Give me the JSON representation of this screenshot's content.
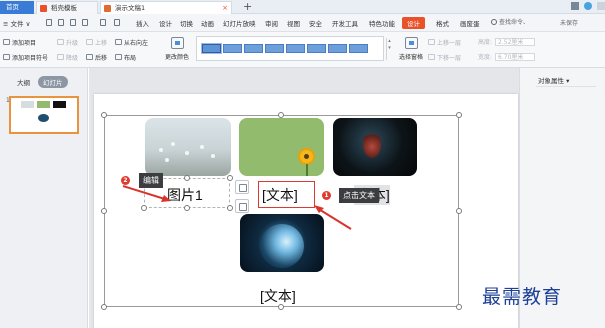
{
  "tabs": {
    "home": "首页",
    "template": "稻壳模板",
    "document": "演示文稿1",
    "close": "×",
    "add": "+"
  },
  "menu": {
    "file": "≡ 文件 ∨",
    "items": [
      "插入",
      "设计",
      "切换",
      "动画",
      "幻灯片放映",
      "审阅",
      "视图",
      "安全",
      "开发工具",
      "特色功能",
      "设计",
      "格式",
      "画废蛋"
    ],
    "active_index": 10,
    "search": "查找命令、",
    "save_status": "未保存"
  },
  "ribbon": {
    "add_item": "添加项目",
    "add_item_sign": "添加项目符号",
    "upgrade": "升级",
    "downgrade": "降级",
    "move_up": "上移",
    "move_down": "后移",
    "right_to_left": "从右向左",
    "layout": "布局",
    "change_color": "更改颜色",
    "select_pane": "选择窗格",
    "up_one": "上移一层",
    "down_one": "下移一层",
    "height_label": "高度:",
    "height_value": "2.52厘米",
    "width_label": "宽度:",
    "width_value": "6.70厘米",
    "gallery_scroll": "▴ ▾"
  },
  "left_panel": {
    "outline_tab": "大纲",
    "slides_tab": "幻灯片",
    "slide_number": "1"
  },
  "right_panel": {
    "title": "对象属性 ▾"
  },
  "slide": {
    "picture_caption": "图片1",
    "text_caption_center": "[文本]",
    "text_caption_right": "[文本]",
    "text_caption_bottom": "[文本]",
    "tooltip_edit": "编辑",
    "tooltip_click_text": "点击文本",
    "badge_1": "1",
    "badge_2": "2"
  },
  "watermark": "最需教育",
  "colors": {
    "accent_orange": "#e8512a",
    "highlight_red": "#d73b32",
    "smartart_blue": "#6d9fdc"
  }
}
